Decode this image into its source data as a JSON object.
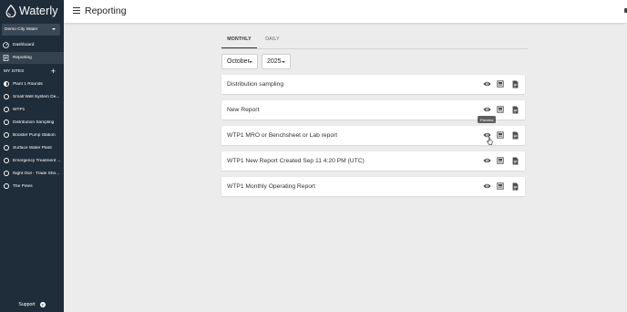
{
  "app": {
    "name": "Waterly",
    "organization": "Demo City Water"
  },
  "sidebar": {
    "nav": [
      {
        "label": "Dashboard",
        "icon": "dashboard-gauge-icon"
      },
      {
        "label": "Reporting",
        "icon": "report-document-icon",
        "active": true
      }
    ],
    "my_sites_label": "MY SITES",
    "add_icon": "plus-icon",
    "sites": [
      {
        "label": "Plant 1 Rounds",
        "icon": "half-circle-icon"
      },
      {
        "label": "Small Well System De..."
      },
      {
        "label": "WTP1"
      },
      {
        "label": "Distribution Sampling"
      },
      {
        "label": "Booster Pump Station"
      },
      {
        "label": "Surface Water Plant"
      },
      {
        "label": "Emergency Treatment ..."
      },
      {
        "label": "Night Owl - Trade Sho..."
      },
      {
        "label": "The Pines"
      }
    ],
    "support_label": "Support",
    "support_icon": "help-icon"
  },
  "header": {
    "title": "Reporting",
    "menu_icon": "hamburger-menu-icon"
  },
  "tabs": [
    {
      "label": "MONTHLY",
      "active": true
    },
    {
      "label": "DAILY",
      "active": false
    }
  ],
  "filters": {
    "month": "October",
    "year": "2025"
  },
  "reports": [
    {
      "name": "Distribution sampling"
    },
    {
      "name": "New Report"
    },
    {
      "name": "WTP1 MRO or Benchsheet or Lab report"
    },
    {
      "name": "WTP1 New Report Created Sep 11 4:20 PM (UTC)"
    },
    {
      "name": "WTP1 Monthly Operating Report"
    }
  ],
  "row_actions": [
    "eye-preview-icon",
    "view-report-icon",
    "document-icon"
  ],
  "tooltip": "Preview",
  "colors": {
    "sidebar_bg": "#1f2d3a",
    "sidebar_active": "#34414e",
    "content_bg": "#ececec",
    "accent_text": "#333333"
  }
}
